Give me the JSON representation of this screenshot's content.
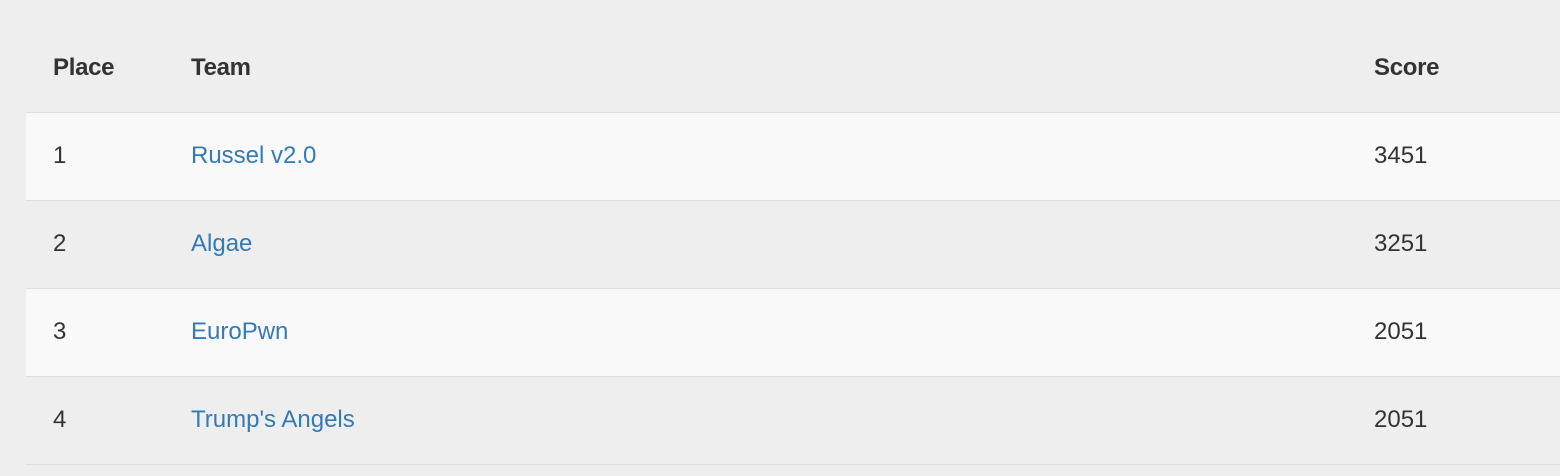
{
  "scoreboard": {
    "headers": {
      "place": "Place",
      "team": "Team",
      "score": "Score"
    },
    "rows": [
      {
        "place": "1",
        "team": "Russel v2.0",
        "score": "3451"
      },
      {
        "place": "2",
        "team": "Algae",
        "score": "3251"
      },
      {
        "place": "3",
        "team": "EuroPwn",
        "score": "2051"
      },
      {
        "place": "4",
        "team": "Trump's Angels",
        "score": "2051"
      }
    ],
    "link_color": "#337ab7"
  }
}
